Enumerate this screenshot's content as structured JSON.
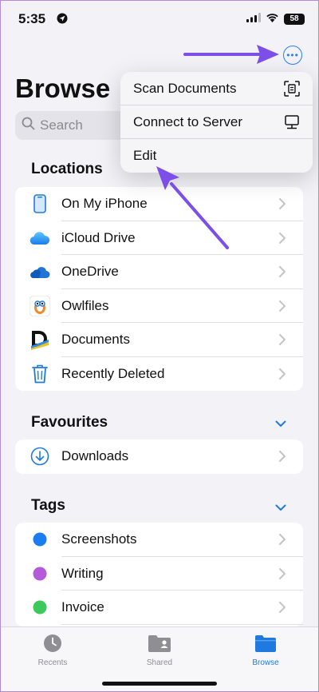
{
  "status_bar": {
    "time": "5:35",
    "battery": "58"
  },
  "header": {
    "title": "Browse",
    "search_placeholder": "Search"
  },
  "menu": {
    "items": [
      {
        "label": "Scan Documents",
        "icon": "scan-icon"
      },
      {
        "label": "Connect to Server",
        "icon": "server-icon"
      },
      {
        "label": "Edit",
        "icon": ""
      }
    ]
  },
  "locations": {
    "header": "Locations",
    "items": [
      {
        "label": "On My iPhone",
        "icon": "iphone-icon"
      },
      {
        "label": "iCloud Drive",
        "icon": "icloud-icon"
      },
      {
        "label": "OneDrive",
        "icon": "onedrive-icon"
      },
      {
        "label": "Owlfiles",
        "icon": "owlfiles-icon"
      },
      {
        "label": "Documents",
        "icon": "documents-icon"
      },
      {
        "label": "Recently Deleted",
        "icon": "trash-icon"
      }
    ]
  },
  "favourites": {
    "header": "Favourites",
    "items": [
      {
        "label": "Downloads",
        "icon": "download-icon"
      }
    ]
  },
  "tags": {
    "header": "Tags",
    "items": [
      {
        "label": "Screenshots",
        "color": "#1a7cf0"
      },
      {
        "label": "Writing",
        "color": "#b45ad8"
      },
      {
        "label": "Invoice",
        "color": "#3cc85a"
      }
    ]
  },
  "tab_bar": {
    "tabs": [
      {
        "label": "Recents",
        "icon": "clock-icon"
      },
      {
        "label": "Shared",
        "icon": "shared-folder-icon"
      },
      {
        "label": "Browse",
        "icon": "folder-icon",
        "active": true
      }
    ]
  },
  "colors": {
    "accent": "#1f7ae0",
    "annotation_arrow": "#7b4fe8"
  }
}
